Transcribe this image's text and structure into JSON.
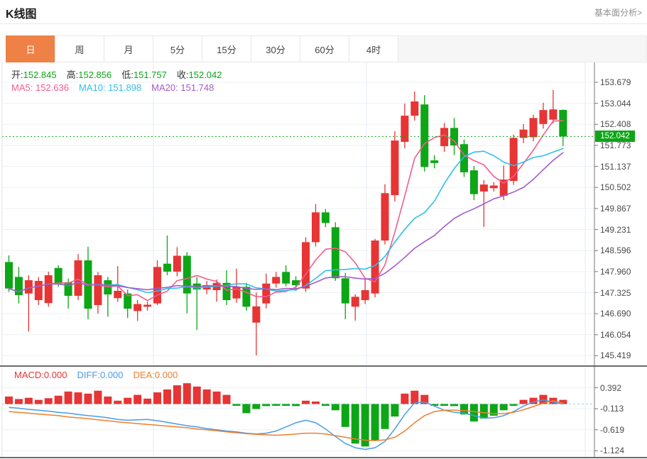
{
  "header": {
    "title": "K线图",
    "link_label": "基本面分析>"
  },
  "tabs": {
    "active": "日",
    "items": [
      "日",
      "周",
      "月",
      "5分",
      "15分",
      "30分",
      "60分",
      "4时"
    ]
  },
  "legend": {
    "ohlc": [
      {
        "label": "开:",
        "value": "152.845"
      },
      {
        "label": "高:",
        "value": "152.856"
      },
      {
        "label": "低:",
        "value": "151.757"
      },
      {
        "label": "收:",
        "value": "152.042"
      }
    ],
    "ma": [
      {
        "label": "MA5:",
        "value": "152.636"
      },
      {
        "label": "MA10:",
        "value": "151.898"
      },
      {
        "label": "MA20:",
        "value": "151.748"
      }
    ],
    "macd": [
      {
        "label": "MACD:",
        "value": "0.000"
      },
      {
        "label": "DIFF:",
        "value": "0.000"
      },
      {
        "label": "DEA:",
        "value": "0.000"
      }
    ]
  },
  "colors": {
    "up": "#e73434",
    "down": "#0da616",
    "ma5": "#f25c8e",
    "ma10": "#2ec0e8",
    "ma20": "#a45bc8",
    "diff": "#4a9be6",
    "dea": "#ee7f2d",
    "tab_active": "#ee8145",
    "price_tag": "#0da616",
    "ohlc_value": "#0da616"
  },
  "chart_data": {
    "type": "candlestick+macd",
    "main": {
      "ticks": [
        "153.679",
        "153.044",
        "152.408",
        "151.773",
        "151.137",
        "150.502",
        "149.867",
        "149.231",
        "148.596",
        "147.960",
        "147.325",
        "146.690",
        "146.054",
        "145.419"
      ],
      "current_price": 152.042,
      "current_price_label": "152.042",
      "ma_windows": [
        5,
        10,
        20
      ],
      "candles": [
        [
          148.25,
          148.45,
          147.35,
          147.45
        ],
        [
          147.8,
          148.1,
          147.0,
          147.25
        ],
        [
          147.3,
          147.85,
          146.15,
          147.7
        ],
        [
          147.1,
          147.8,
          146.95,
          147.68
        ],
        [
          147.01,
          147.96,
          146.9,
          147.85
        ],
        [
          148.07,
          148.15,
          147.5,
          147.6
        ],
        [
          147.64,
          147.75,
          146.84,
          147.23
        ],
        [
          147.23,
          148.49,
          147.1,
          148.3
        ],
        [
          148.3,
          148.71,
          146.52,
          146.84
        ],
        [
          146.95,
          147.95,
          146.69,
          147.85
        ],
        [
          147.7,
          147.8,
          146.6,
          147.27
        ],
        [
          147.16,
          148.13,
          147.05,
          147.38
        ],
        [
          147.3,
          147.42,
          146.56,
          146.84
        ],
        [
          146.77,
          147.1,
          146.47,
          146.98
        ],
        [
          146.9,
          147.05,
          146.78,
          146.96
        ],
        [
          147.0,
          148.3,
          146.95,
          148.1
        ],
        [
          148.2,
          149.05,
          147.85,
          147.96
        ],
        [
          147.96,
          148.7,
          147.82,
          148.44
        ],
        [
          148.44,
          148.55,
          146.7,
          147.3
        ],
        [
          147.6,
          147.8,
          146.2,
          147.42
        ],
        [
          147.42,
          147.68,
          147.28,
          147.55
        ],
        [
          147.4,
          147.72,
          147.05,
          147.62
        ],
        [
          147.62,
          148.0,
          146.95,
          147.1
        ],
        [
          147.15,
          148.05,
          147.02,
          147.5
        ],
        [
          147.5,
          147.62,
          146.78,
          146.9
        ],
        [
          146.42,
          147.33,
          145.43,
          146.91
        ],
        [
          147.0,
          147.9,
          146.85,
          147.6
        ],
        [
          147.6,
          147.95,
          147.48,
          147.8
        ],
        [
          147.95,
          148.15,
          147.52,
          147.6
        ],
        [
          147.7,
          147.82,
          147.38,
          147.55
        ],
        [
          147.45,
          149.0,
          147.35,
          148.85
        ],
        [
          148.85,
          150.0,
          148.72,
          149.75
        ],
        [
          149.75,
          149.85,
          149.3,
          149.43
        ],
        [
          149.3,
          149.45,
          147.68,
          147.76
        ],
        [
          147.76,
          147.92,
          146.52,
          147.0
        ],
        [
          146.9,
          147.28,
          146.48,
          147.2
        ],
        [
          147.1,
          147.76,
          146.98,
          147.4
        ],
        [
          147.3,
          148.95,
          147.18,
          148.9
        ],
        [
          148.9,
          150.6,
          148.78,
          150.33
        ],
        [
          150.27,
          152.2,
          150.08,
          151.92
        ],
        [
          151.88,
          153.04,
          151.68,
          152.67
        ],
        [
          152.67,
          153.4,
          152.52,
          153.1
        ],
        [
          153.01,
          153.29,
          150.98,
          151.12
        ],
        [
          151.32,
          151.48,
          151.08,
          151.24
        ],
        [
          151.75,
          152.45,
          151.58,
          152.3
        ],
        [
          152.3,
          152.6,
          151.48,
          151.77
        ],
        [
          151.81,
          151.95,
          150.82,
          150.96
        ],
        [
          151.02,
          151.15,
          150.12,
          150.3
        ],
        [
          150.38,
          150.72,
          149.31,
          150.59
        ],
        [
          150.48,
          150.66,
          150.38,
          150.56
        ],
        [
          150.25,
          151.17,
          150.12,
          150.74
        ],
        [
          150.7,
          152.1,
          150.58,
          152.0
        ],
        [
          152.0,
          152.42,
          151.84,
          152.25
        ],
        [
          152.02,
          152.7,
          151.9,
          152.6
        ],
        [
          152.42,
          153.06,
          152.28,
          152.84
        ],
        [
          152.55,
          153.45,
          152.44,
          152.86
        ],
        [
          152.845,
          152.856,
          151.757,
          152.042
        ]
      ]
    },
    "macd": {
      "ticks": [
        "0.392",
        "-0.113",
        "-0.619",
        "-1.124"
      ],
      "hist": [
        0.18,
        0.12,
        0.15,
        0.1,
        0.14,
        0.2,
        0.3,
        0.28,
        0.25,
        0.32,
        0.18,
        0.08,
        0.15,
        0.22,
        0.13,
        0.28,
        0.35,
        0.45,
        0.5,
        0.42,
        0.35,
        0.3,
        0.22,
        -0.03,
        -0.22,
        -0.12,
        -0.05,
        -0.04,
        -0.03,
        -0.05,
        0.08,
        0.06,
        -0.04,
        -0.15,
        -0.55,
        -0.95,
        -1.02,
        -0.88,
        -0.6,
        -0.3,
        0.25,
        0.32,
        0.22,
        -0.03,
        -0.04,
        -0.05,
        -0.25,
        -0.42,
        -0.35,
        -0.28,
        -0.15,
        -0.04,
        0.1,
        0.15,
        0.22,
        0.15,
        0.1
      ],
      "diff": [
        -0.08,
        -0.1,
        -0.13,
        -0.15,
        -0.17,
        -0.2,
        -0.22,
        -0.25,
        -0.28,
        -0.3,
        -0.33,
        -0.37,
        -0.39,
        -0.38,
        -0.37,
        -0.4,
        -0.44,
        -0.48,
        -0.52,
        -0.55,
        -0.59,
        -0.62,
        -0.65,
        -0.67,
        -0.7,
        -0.72,
        -0.7,
        -0.65,
        -0.55,
        -0.45,
        -0.39,
        -0.45,
        -0.6,
        -0.78,
        -0.95,
        -1.05,
        -1.09,
        -1.05,
        -0.9,
        -0.6,
        -0.25,
        0.03,
        0.05,
        -0.05,
        -0.15,
        -0.2,
        -0.22,
        -0.28,
        -0.34,
        -0.33,
        -0.28,
        -0.18,
        -0.05,
        0.05,
        0.1,
        0.05,
        0.0
      ],
      "dea": [
        -0.18,
        -0.2,
        -0.22,
        -0.24,
        -0.26,
        -0.28,
        -0.31,
        -0.33,
        -0.35,
        -0.38,
        -0.4,
        -0.43,
        -0.45,
        -0.47,
        -0.49,
        -0.51,
        -0.53,
        -0.55,
        -0.57,
        -0.6,
        -0.62,
        -0.64,
        -0.67,
        -0.69,
        -0.71,
        -0.73,
        -0.74,
        -0.75,
        -0.74,
        -0.72,
        -0.7,
        -0.7,
        -0.72,
        -0.76,
        -0.8,
        -0.84,
        -0.87,
        -0.88,
        -0.86,
        -0.8,
        -0.65,
        -0.45,
        -0.28,
        -0.18,
        -0.15,
        -0.15,
        -0.16,
        -0.18,
        -0.21,
        -0.23,
        -0.23,
        -0.2,
        -0.14,
        -0.06,
        0.02,
        0.08,
        0.02
      ]
    }
  }
}
